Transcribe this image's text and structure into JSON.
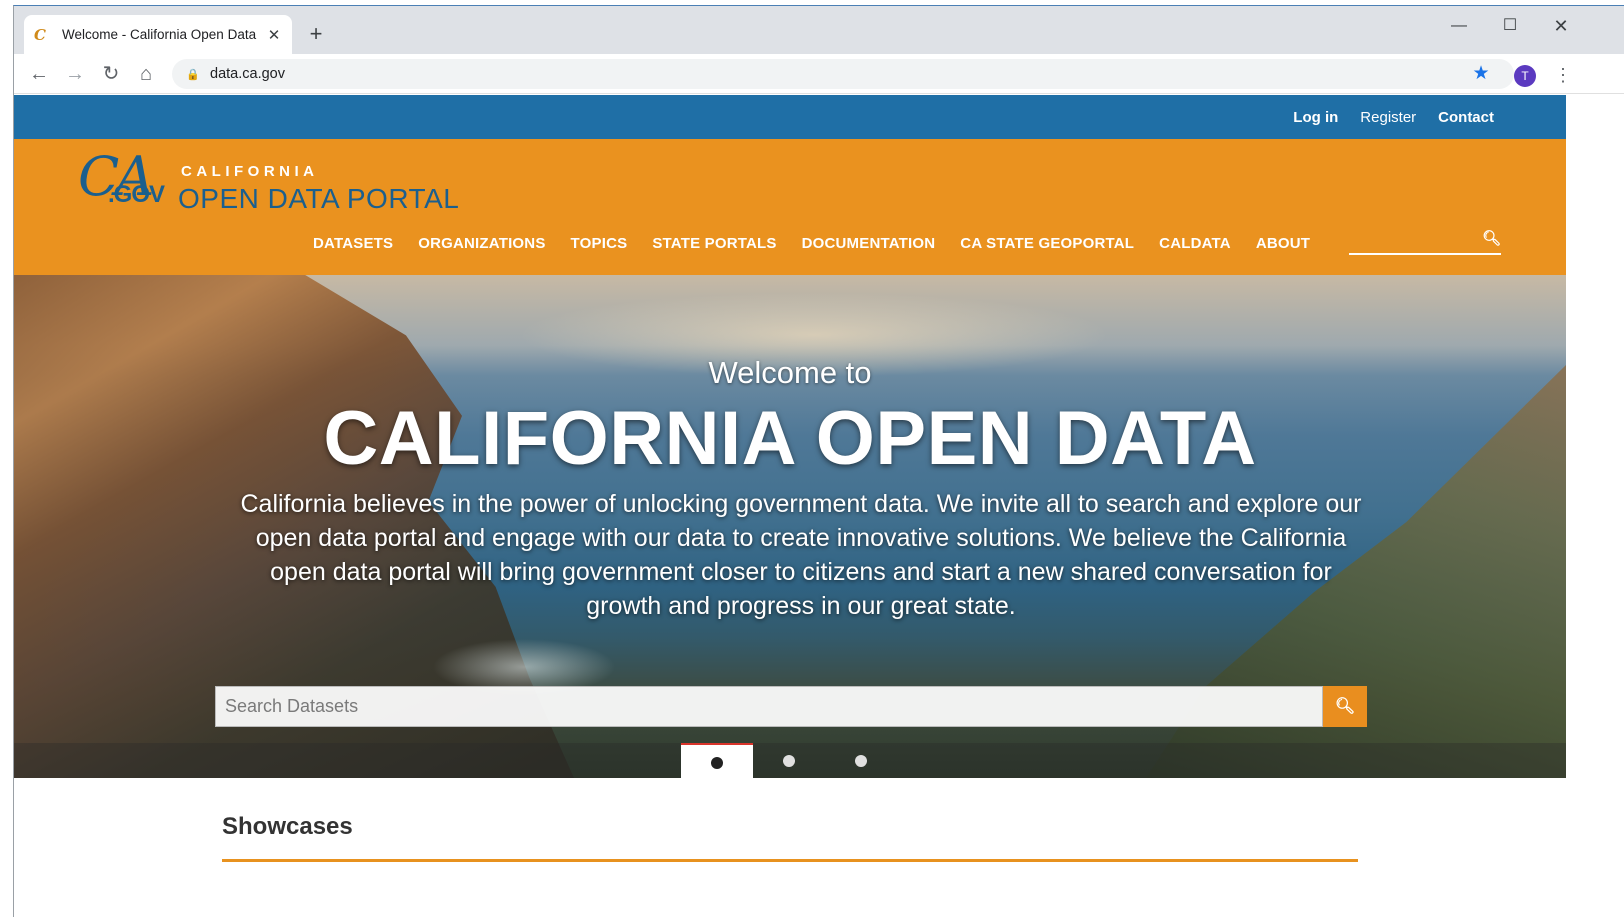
{
  "browser": {
    "tab_title": "Welcome - California Open Data",
    "tab_close": "✕",
    "new_tab": "+",
    "url": "data.ca.gov",
    "profile_initial": "T",
    "icons": [
      "back-icon",
      "forward-icon",
      "reload-icon",
      "home-icon",
      "lock-icon",
      "star-icon",
      "menu-icon"
    ]
  },
  "utility_nav": {
    "login": "Log in",
    "register": "Register",
    "contact": "Contact"
  },
  "logo": {
    "ca": "CA",
    "gov": ".GOV",
    "top_line": "CALIFORNIA",
    "bottom_line": "OPEN DATA PORTAL"
  },
  "main_nav": {
    "items": [
      "DATASETS",
      "ORGANIZATIONS",
      "TOPICS",
      "STATE PORTALS",
      "DOCUMENTATION",
      "CA STATE GEOPORTAL",
      "CALDATA",
      "ABOUT"
    ]
  },
  "hero": {
    "welcome": "Welcome to",
    "title": "CALIFORNIA OPEN DATA",
    "body": "California believes in the power of unlocking government data. We invite all to search and explore our open data portal and engage with our data to create innovative solutions. We believe the California open data portal will bring government closer to citizens and start a new shared conversation for growth and progress in our great state.",
    "search_placeholder": "Search Datasets",
    "carousel_active_index": 0,
    "carousel_count": 3
  },
  "showcases": {
    "heading": "Showcases"
  },
  "colors": {
    "utility_bar": "#1f6fa6",
    "header": "#ea921f",
    "logo_blue": "#1b5f8e",
    "accent_orange": "#e98e1f"
  }
}
